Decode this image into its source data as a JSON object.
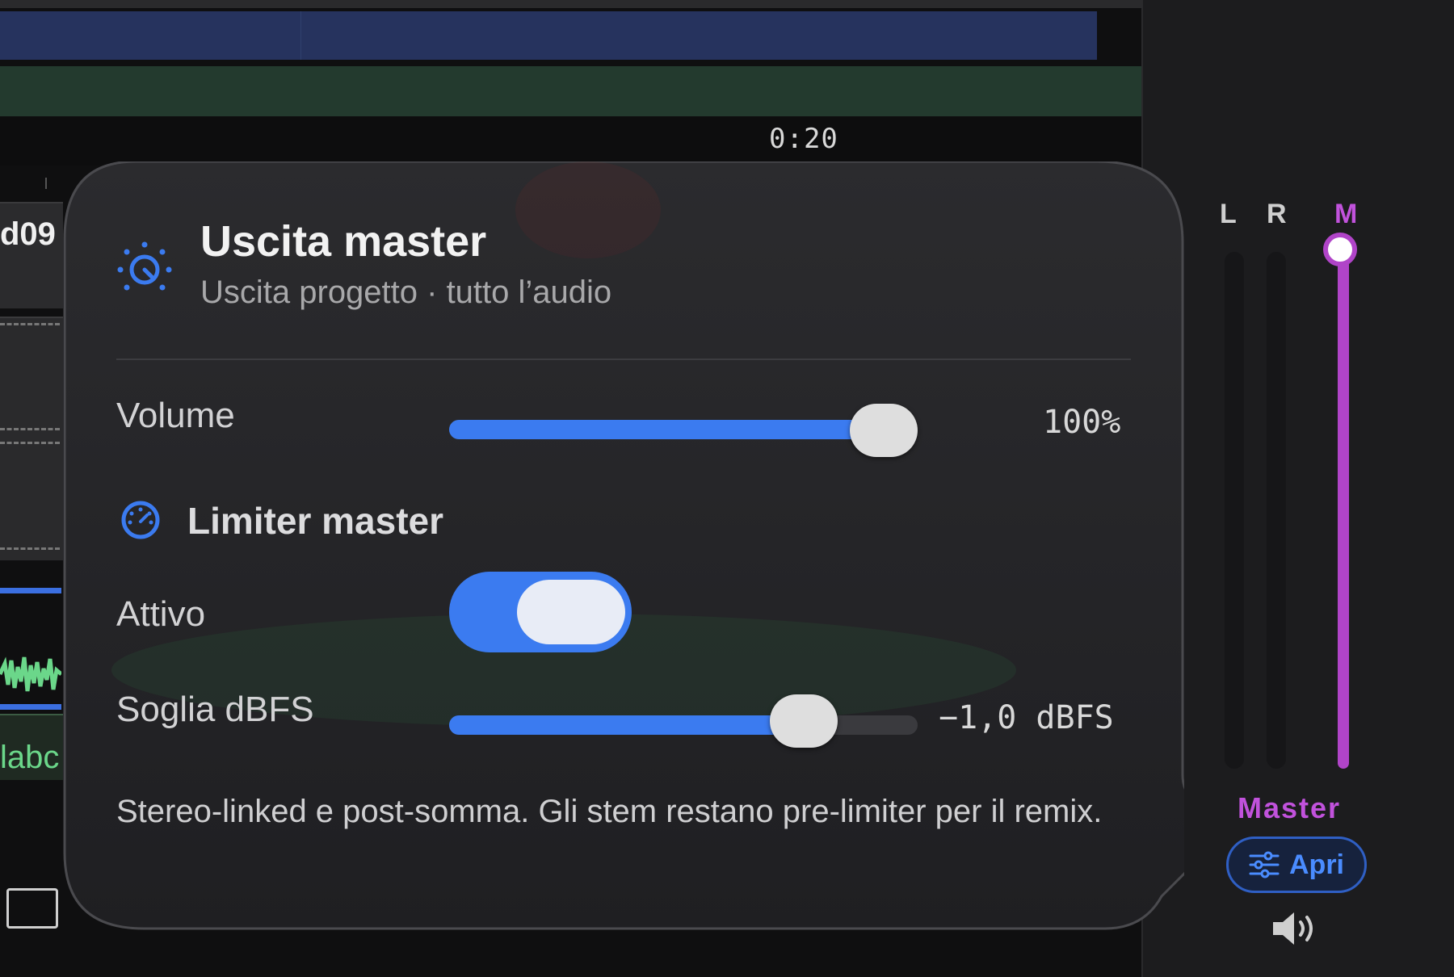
{
  "timeline": {
    "timecode": "0:20",
    "track_label_top": "d09",
    "track_label_bottom": "labc"
  },
  "mixer": {
    "channels": [
      "L",
      "R",
      "M"
    ],
    "master_label": "Master",
    "open_button": "Apri",
    "master_level": 1.0,
    "colors": {
      "master": "#b044c8",
      "accent": "#3b7bf0"
    }
  },
  "popover": {
    "icon": "gauge-knob-icon",
    "title": "Uscita master",
    "subtitle": "Uscita progetto · tutto l’audio",
    "volume": {
      "label": "Volume",
      "value_text": "100%",
      "fraction": 1.0
    },
    "limiter": {
      "section_title": "Limiter master",
      "icon": "gauge-icon",
      "active_label": "Attivo",
      "active": true,
      "threshold_label": "Soglia dBFS",
      "threshold_text": "−1,0 dBFS",
      "threshold_fraction": 0.8
    },
    "note": "Stereo-linked e post-somma. Gli stem restano pre-limiter per il remix."
  }
}
